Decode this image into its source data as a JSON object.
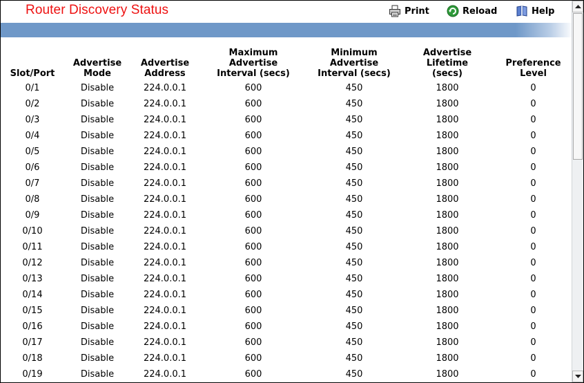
{
  "page": {
    "title": "Router Discovery Status"
  },
  "toolbar": {
    "print_label": "Print",
    "reload_label": "Reload",
    "help_label": "Help"
  },
  "colors": {
    "title": "#ee1111",
    "bar": "#6f98c8"
  },
  "icons": {
    "print": "printer-icon",
    "reload": "reload-icon",
    "help": "help-book-icon"
  },
  "table": {
    "headers": [
      "Slot/Port",
      "Advertise\nMode",
      "Advertise\nAddress",
      "Maximum\nAdvertise\nInterval (secs)",
      "Minimum\nAdvertise\nInterval (secs)",
      "Advertise\nLifetime\n(secs)",
      "Preference\nLevel"
    ],
    "rows": [
      [
        "0/1",
        "Disable",
        "224.0.0.1",
        "600",
        "450",
        "1800",
        "0"
      ],
      [
        "0/2",
        "Disable",
        "224.0.0.1",
        "600",
        "450",
        "1800",
        "0"
      ],
      [
        "0/3",
        "Disable",
        "224.0.0.1",
        "600",
        "450",
        "1800",
        "0"
      ],
      [
        "0/4",
        "Disable",
        "224.0.0.1",
        "600",
        "450",
        "1800",
        "0"
      ],
      [
        "0/5",
        "Disable",
        "224.0.0.1",
        "600",
        "450",
        "1800",
        "0"
      ],
      [
        "0/6",
        "Disable",
        "224.0.0.1",
        "600",
        "450",
        "1800",
        "0"
      ],
      [
        "0/7",
        "Disable",
        "224.0.0.1",
        "600",
        "450",
        "1800",
        "0"
      ],
      [
        "0/8",
        "Disable",
        "224.0.0.1",
        "600",
        "450",
        "1800",
        "0"
      ],
      [
        "0/9",
        "Disable",
        "224.0.0.1",
        "600",
        "450",
        "1800",
        "0"
      ],
      [
        "0/10",
        "Disable",
        "224.0.0.1",
        "600",
        "450",
        "1800",
        "0"
      ],
      [
        "0/11",
        "Disable",
        "224.0.0.1",
        "600",
        "450",
        "1800",
        "0"
      ],
      [
        "0/12",
        "Disable",
        "224.0.0.1",
        "600",
        "450",
        "1800",
        "0"
      ],
      [
        "0/13",
        "Disable",
        "224.0.0.1",
        "600",
        "450",
        "1800",
        "0"
      ],
      [
        "0/14",
        "Disable",
        "224.0.0.1",
        "600",
        "450",
        "1800",
        "0"
      ],
      [
        "0/15",
        "Disable",
        "224.0.0.1",
        "600",
        "450",
        "1800",
        "0"
      ],
      [
        "0/16",
        "Disable",
        "224.0.0.1",
        "600",
        "450",
        "1800",
        "0"
      ],
      [
        "0/17",
        "Disable",
        "224.0.0.1",
        "600",
        "450",
        "1800",
        "0"
      ],
      [
        "0/18",
        "Disable",
        "224.0.0.1",
        "600",
        "450",
        "1800",
        "0"
      ],
      [
        "0/19",
        "Disable",
        "224.0.0.1",
        "600",
        "450",
        "1800",
        "0"
      ]
    ]
  }
}
